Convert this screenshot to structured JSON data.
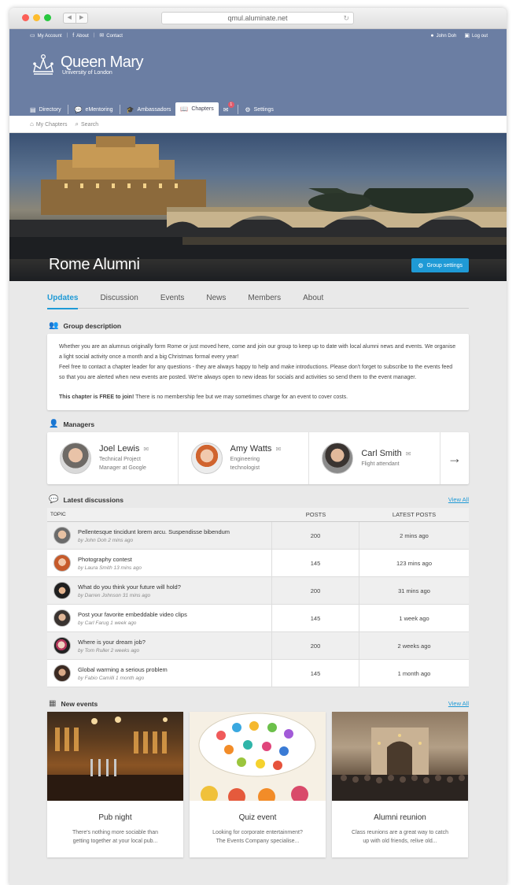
{
  "browser": {
    "url": "qmul.aluminate.net"
  },
  "topbar": {
    "my_account": "My Account",
    "about": "About",
    "contact": "Contact",
    "user": "John Doh",
    "logout": "Log out"
  },
  "brand": {
    "title": "Queen Mary",
    "subtitle": "University of London"
  },
  "main_tabs": [
    {
      "label": "Directory",
      "icon": "directory-icon"
    },
    {
      "label": "eMentoring",
      "icon": "chat-icon"
    },
    {
      "label": "Ambassadors",
      "icon": "graduation-cap-icon"
    },
    {
      "label": "Chapters",
      "icon": "book-icon"
    },
    {
      "label": "Settings",
      "icon": "gear-icon"
    }
  ],
  "messages_badge": "1",
  "subnav": {
    "my_chapters": "My Chapters",
    "search": "Search"
  },
  "hero": {
    "title": "Rome Alumni",
    "settings_button": "Group settings"
  },
  "page_tabs": [
    "Updates",
    "Discussion",
    "Events",
    "News",
    "Members",
    "About"
  ],
  "group_description": {
    "heading": "Group description",
    "p1": "Whether you are an alumnus originally form Rome or just moved here, come and join our group to keep up to date with local alumni news and events. We organise a light social activity once a month and a big Christmas formal every year!",
    "p2": "Feel free to contact a chapter leader for any questions - they are always happy to help and make introductions. Please don't forget to subscribe to the events feed so that you are alerted when new events are posted. We're always open to new ideas for socials and activities so send them to the event manager.",
    "bold": "This chapter is FREE to join!",
    "rest": " There is no membership fee but we may sometimes charge for an event to cover costs."
  },
  "managers": {
    "heading": "Managers",
    "items": [
      {
        "name": "Joel Lewis",
        "role1": "Technical Project",
        "role2": "Manager at Google"
      },
      {
        "name": "Amy Watts",
        "role1": "Engineering",
        "role2": "technologist"
      },
      {
        "name": "Carl Smith",
        "role1": "Flight attendant",
        "role2": ""
      }
    ]
  },
  "discussions": {
    "heading": "Latest discussions",
    "view_all": "View All",
    "col_topic": "TOPIC",
    "col_posts": "POSTS",
    "col_latest": "LATEST POSTS",
    "rows": [
      {
        "title": "Pellentesque tincidunt lorem arcu. Suspendisse bibendum",
        "by": "by John Doh 2 mins ago",
        "posts": "200",
        "latest": "2 mins ago"
      },
      {
        "title": "Photography contest",
        "by": "by Laura Smith 13 mins ago",
        "posts": "145",
        "latest": "123 mins ago"
      },
      {
        "title": "What do you think your future will hold?",
        "by": "by Darren Johnson 31 mins ago",
        "posts": "200",
        "latest": "31 mins ago"
      },
      {
        "title": "Post your favorite embeddable video clips",
        "by": "by Carl Farug 1 week ago",
        "posts": "145",
        "latest": "1 week ago"
      },
      {
        "title": "Where is your dream job?",
        "by": "by Tom Ruller 2 weeks ago",
        "posts": "200",
        "latest": "2 weeks ago"
      },
      {
        "title": "Global warming a serious problem",
        "by": "by Fabio Camilli 1 month ago",
        "posts": "145",
        "latest": "1 month ago"
      }
    ]
  },
  "events": {
    "heading": "New events",
    "view_all": "View All",
    "items": [
      {
        "title": "Pub night",
        "desc1": "There's nothing more sociable than",
        "desc2": "getting together at your local pub..."
      },
      {
        "title": "Quiz event",
        "desc1": "Looking for corporate entertainment?",
        "desc2": "The Events Company specialise..."
      },
      {
        "title": "Alumni reunion",
        "desc1": "Class reunions are a great way to catch",
        "desc2": "up with old friends, relive old..."
      }
    ]
  },
  "colors": {
    "header": "#6b7ea3",
    "accent": "#1f9ad6",
    "background": "#e9e9e9"
  }
}
